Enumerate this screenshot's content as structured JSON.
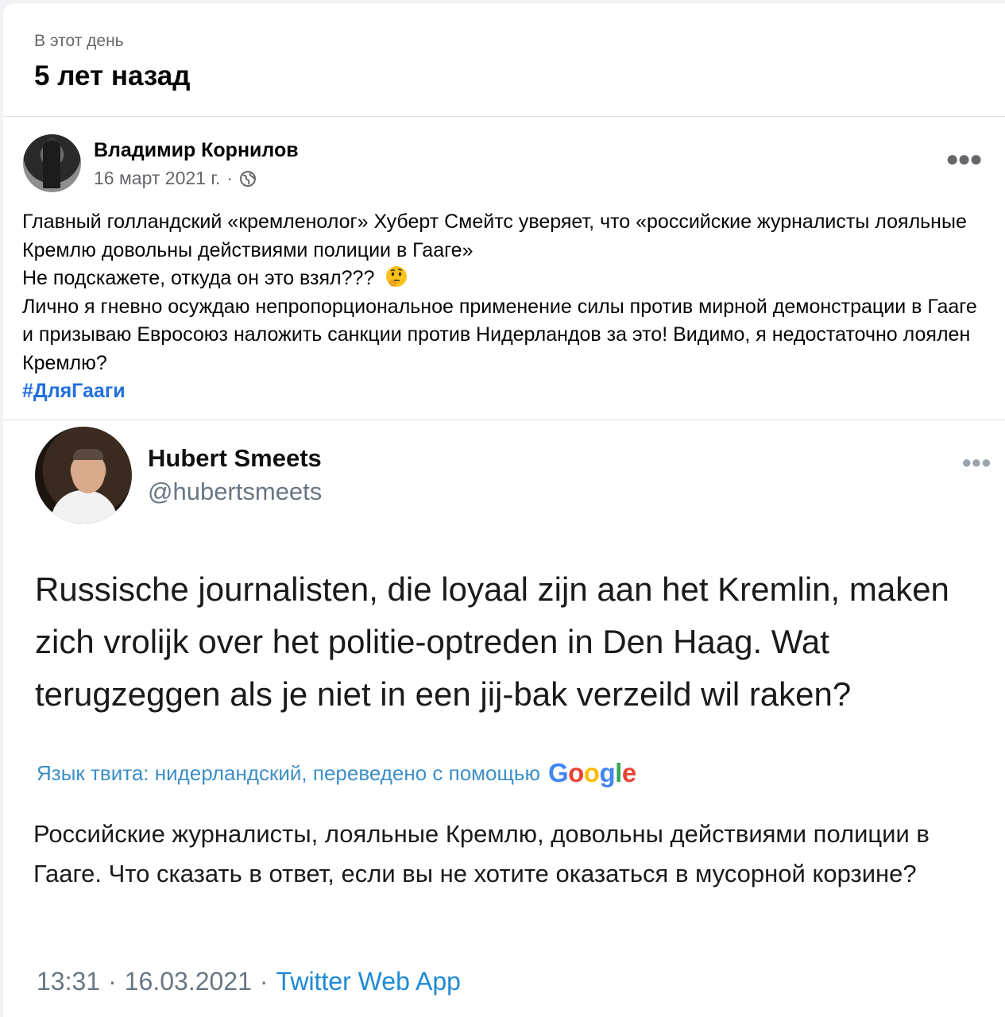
{
  "memory": {
    "kicker": "В этот день",
    "title": "5 лет назад"
  },
  "post": {
    "author": "Владимир Корнилов",
    "date": "16 март 2021 г.",
    "separator": "·",
    "audience_icon": "globe-icon",
    "more_icon": "more-options-icon",
    "lines": [
      "Главный голландский «кремленолог» Хуберт Смейтс уверяет, что «российские журналисты лояльные Кремлю довольны действиями полиции в Гааге»",
      "Не подскажете, откуда он это взял???",
      "Лично я гневно осуждаю непропорциональное применение силы против мирной демонстрации в Гааге и призываю Евросоюз наложить санкции против Нидерландов за это! Видимо, я недостаточно лоялен Кремлю?"
    ],
    "emoji": "thinking-face-emoji",
    "hashtag": "#ДляГааги"
  },
  "tweet": {
    "name": "Hubert Smeets",
    "handle": "@hubertsmeets",
    "original_text": "Russische journalisten, die loyaal zijn aan het Kremlin, maken zich vrolijk over het politie-optreden in Den Haag. Wat terugzeggen als je niet in een jij-bak verzeild wil raken?",
    "translate_label": "Язык твита: нидерландский, переведено с помощью",
    "google_logo": {
      "text": "Google",
      "colors": [
        "#4285f4",
        "#ea4335",
        "#fbbc05",
        "#4285f4",
        "#34a853",
        "#ea4335"
      ]
    },
    "translation": "Российские журналисты, лояльные Кремлю, довольны действиями полиции в Гааге. Что сказать в ответ, если вы не хотите оказаться в мусорной корзине?",
    "time": "13:31",
    "date": "16.03.2021",
    "separator": "·",
    "source": "Twitter Web App"
  },
  "colors": {
    "hashtag": "#216fdb",
    "translate_link": "#3d8fc7",
    "source_link": "#1d8ad6",
    "secondary": "#65676b"
  }
}
